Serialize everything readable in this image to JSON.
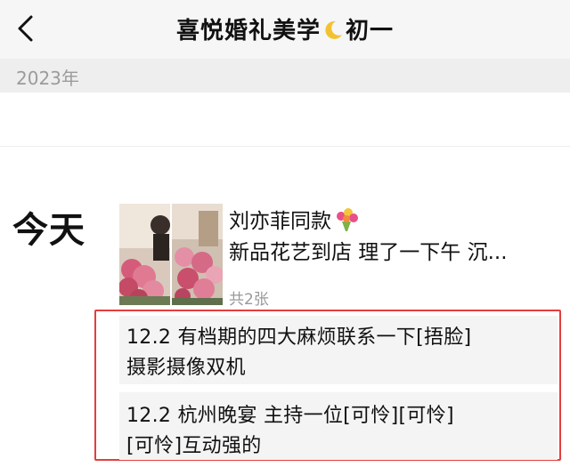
{
  "header": {
    "title_left": "喜悦婚礼美学",
    "title_right": "初一",
    "icons": {
      "back": "chevron-left-icon",
      "moon": "crescent-moon-icon"
    }
  },
  "year_label": "2023年",
  "today_label": "今天",
  "post": {
    "line1": "刘亦菲同款",
    "line2": "新品花艺到店  理了一下午  沉...",
    "photo_count": "共2张",
    "icon": "bouquet-icon"
  },
  "highlighted_posts": [
    {
      "line1": "12.2 有档期的四大麻烦联系一下[捂脸]",
      "line2": "摄影摄像双机"
    },
    {
      "line1": "12.2 杭州晚宴 主持一位[可怜][可怜]",
      "line2": "[可怜]互动强的"
    }
  ],
  "colors": {
    "highlight_border": "#e43d3d",
    "card_bg": "#f4f4f4",
    "header_bg": "#f6f6f6",
    "muted_text": "#9b9b9b"
  }
}
